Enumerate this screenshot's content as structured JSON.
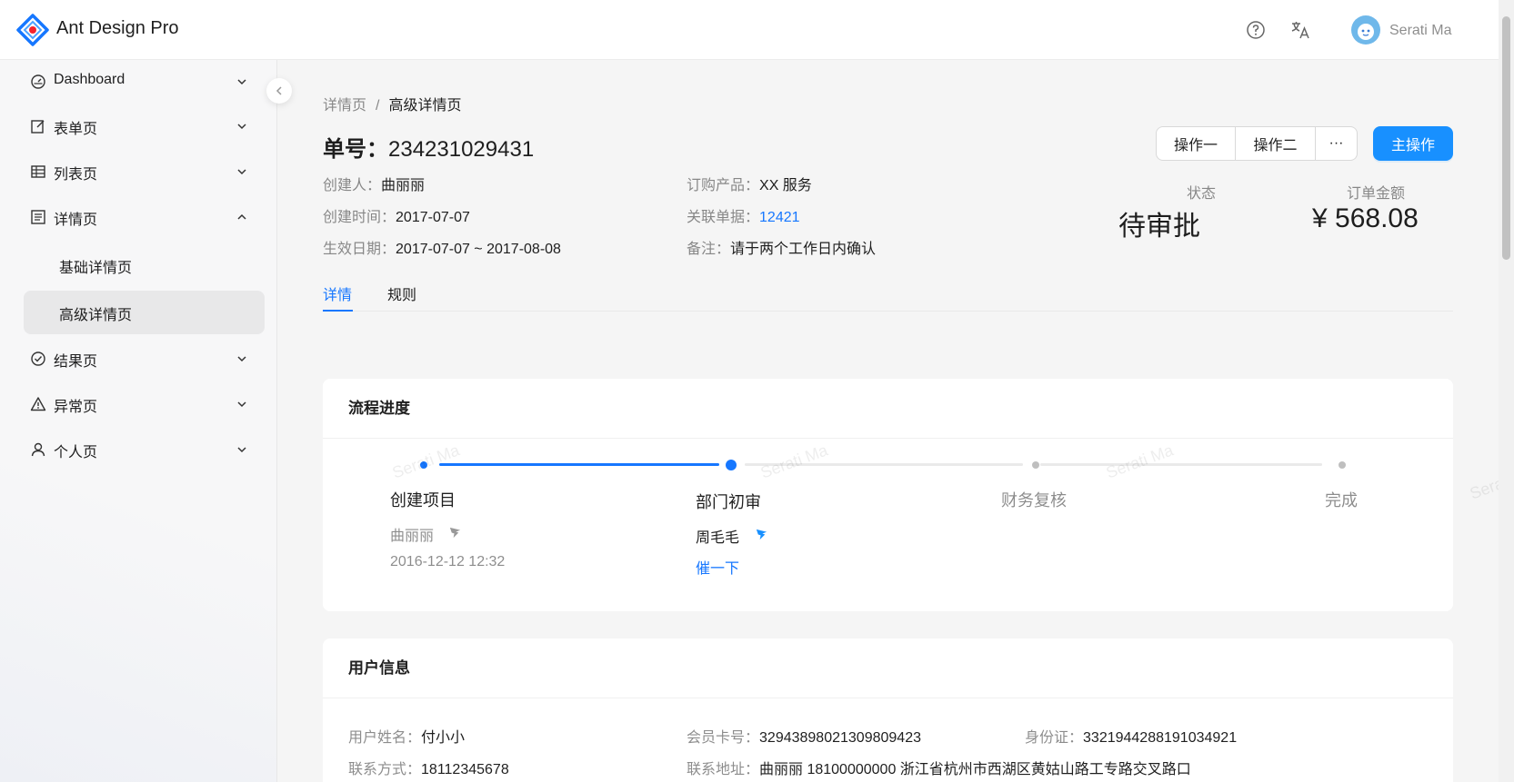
{
  "header": {
    "app_title": "Ant Design Pro",
    "help_icon": "question-circle-icon",
    "language_icon": "translation-icon",
    "user_name": "Serati Ma"
  },
  "sidebar": {
    "items": [
      {
        "label": "Dashboard",
        "icon": "dashboard-icon",
        "expanded": false
      },
      {
        "label": "表单页",
        "icon": "form-icon",
        "expanded": false
      },
      {
        "label": "列表页",
        "icon": "table-icon",
        "expanded": false
      },
      {
        "label": "详情页",
        "icon": "profile-icon",
        "expanded": true
      },
      {
        "label": "结果页",
        "icon": "check-circle-icon",
        "expanded": false
      },
      {
        "label": "异常页",
        "icon": "warning-icon",
        "expanded": false
      },
      {
        "label": "个人页",
        "icon": "user-icon",
        "expanded": false
      }
    ],
    "subitems": [
      {
        "label": "基础详情页",
        "active": false
      },
      {
        "label": "高级详情页",
        "active": true
      }
    ]
  },
  "breadcrumb": {
    "parent": "详情页",
    "separator": "/",
    "current": "高级详情页"
  },
  "page": {
    "title_label": "单号：",
    "title_number": "234231029431",
    "actions": {
      "op1": "操作一",
      "op2": "操作二",
      "more": "···",
      "primary": "主操作"
    }
  },
  "description": {
    "creator_label": "创建人：",
    "creator": "曲丽丽",
    "product_label": "订购产品：",
    "product": "XX 服务",
    "created_label": "创建时间：",
    "created": "2017-07-07",
    "related_label": "关联单据：",
    "related": "12421",
    "effective_label": "生效日期：",
    "effective": "2017-07-07 ~ 2017-08-08",
    "remark_label": "备注：",
    "remark": "请于两个工作日内确认"
  },
  "stats": {
    "status_label": "状态",
    "status_value": "待审批",
    "amount_label": "订单金额",
    "amount_value": "¥ 568.08"
  },
  "tabs": [
    {
      "label": "详情",
      "active": true
    },
    {
      "label": "规则",
      "active": false
    }
  ],
  "process": {
    "title": "流程进度",
    "steps": [
      {
        "title": "创建项目",
        "person": "曲丽丽",
        "time": "2016-12-12 12:32",
        "status": "finish"
      },
      {
        "title": "部门初审",
        "person": "周毛毛",
        "action": "催一下",
        "status": "process"
      },
      {
        "title": "财务复核",
        "status": "wait"
      },
      {
        "title": "完成",
        "status": "wait"
      }
    ],
    "watermark": "Serati Ma"
  },
  "user_info": {
    "title": "用户信息",
    "name_label": "用户姓名：",
    "name": "付小小",
    "card_label": "会员卡号：",
    "card": "32943898021309809423",
    "id_label": "身份证：",
    "id": "3321944288191034921",
    "phone_label": "联系方式：",
    "phone": "18112345678",
    "address_label": "联系地址：",
    "address": "曲丽丽 18100000000 浙江省杭州市西湖区黄姑山路工专路交叉路口"
  },
  "colors": {
    "primary": "#1890ff",
    "link": "#1677ff"
  }
}
